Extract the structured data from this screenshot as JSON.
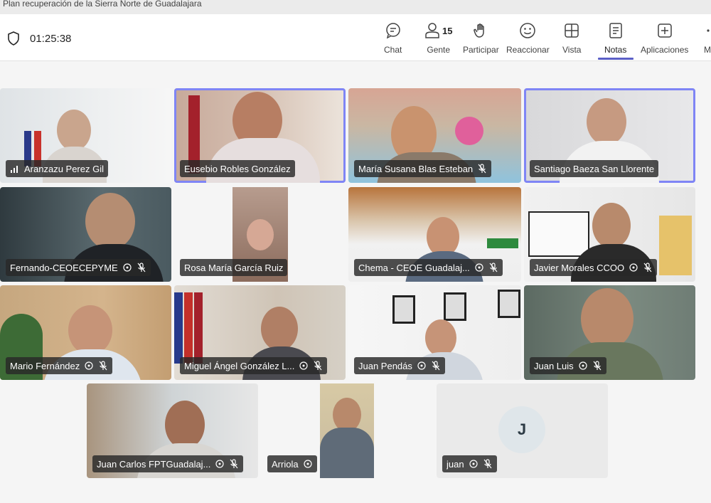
{
  "window": {
    "title": "Plan recuperación de la Sierra Norte de Guadalajara"
  },
  "meeting": {
    "elapsed": "01:25:38"
  },
  "toolbar": {
    "chat": "Chat",
    "people": "Gente",
    "people_count": "15",
    "raise": "Participar",
    "react": "Reaccionar",
    "view": "Vista",
    "notes": "Notas",
    "apps": "Aplicaciones",
    "more": "M"
  },
  "participants": [
    {
      "name": "Aranzazu Perez Gil"
    },
    {
      "name": "Eusebio Robles González"
    },
    {
      "name": "María Susana Blas Esteban"
    },
    {
      "name": "Santiago Baeza San Llorente"
    },
    {
      "name": "Fernando-CEOECEPYME"
    },
    {
      "name": "Rosa María García Ruiz"
    },
    {
      "name": "Chema - CEOE Guadalaj..."
    },
    {
      "name": "Javier Morales CCOO"
    },
    {
      "name": "Mario Fernández"
    },
    {
      "name": "Miguel Ángel González L..."
    },
    {
      "name": "Juan Pendás"
    },
    {
      "name": "Juan Luis"
    },
    {
      "name": "Juan Carlos FPTGuadalaj..."
    },
    {
      "name": "Arriola"
    },
    {
      "name": "juan",
      "initial": "J"
    }
  ],
  "colors": {
    "accent": "#5b5fc7",
    "speaking_outline": "#7f85f5"
  }
}
